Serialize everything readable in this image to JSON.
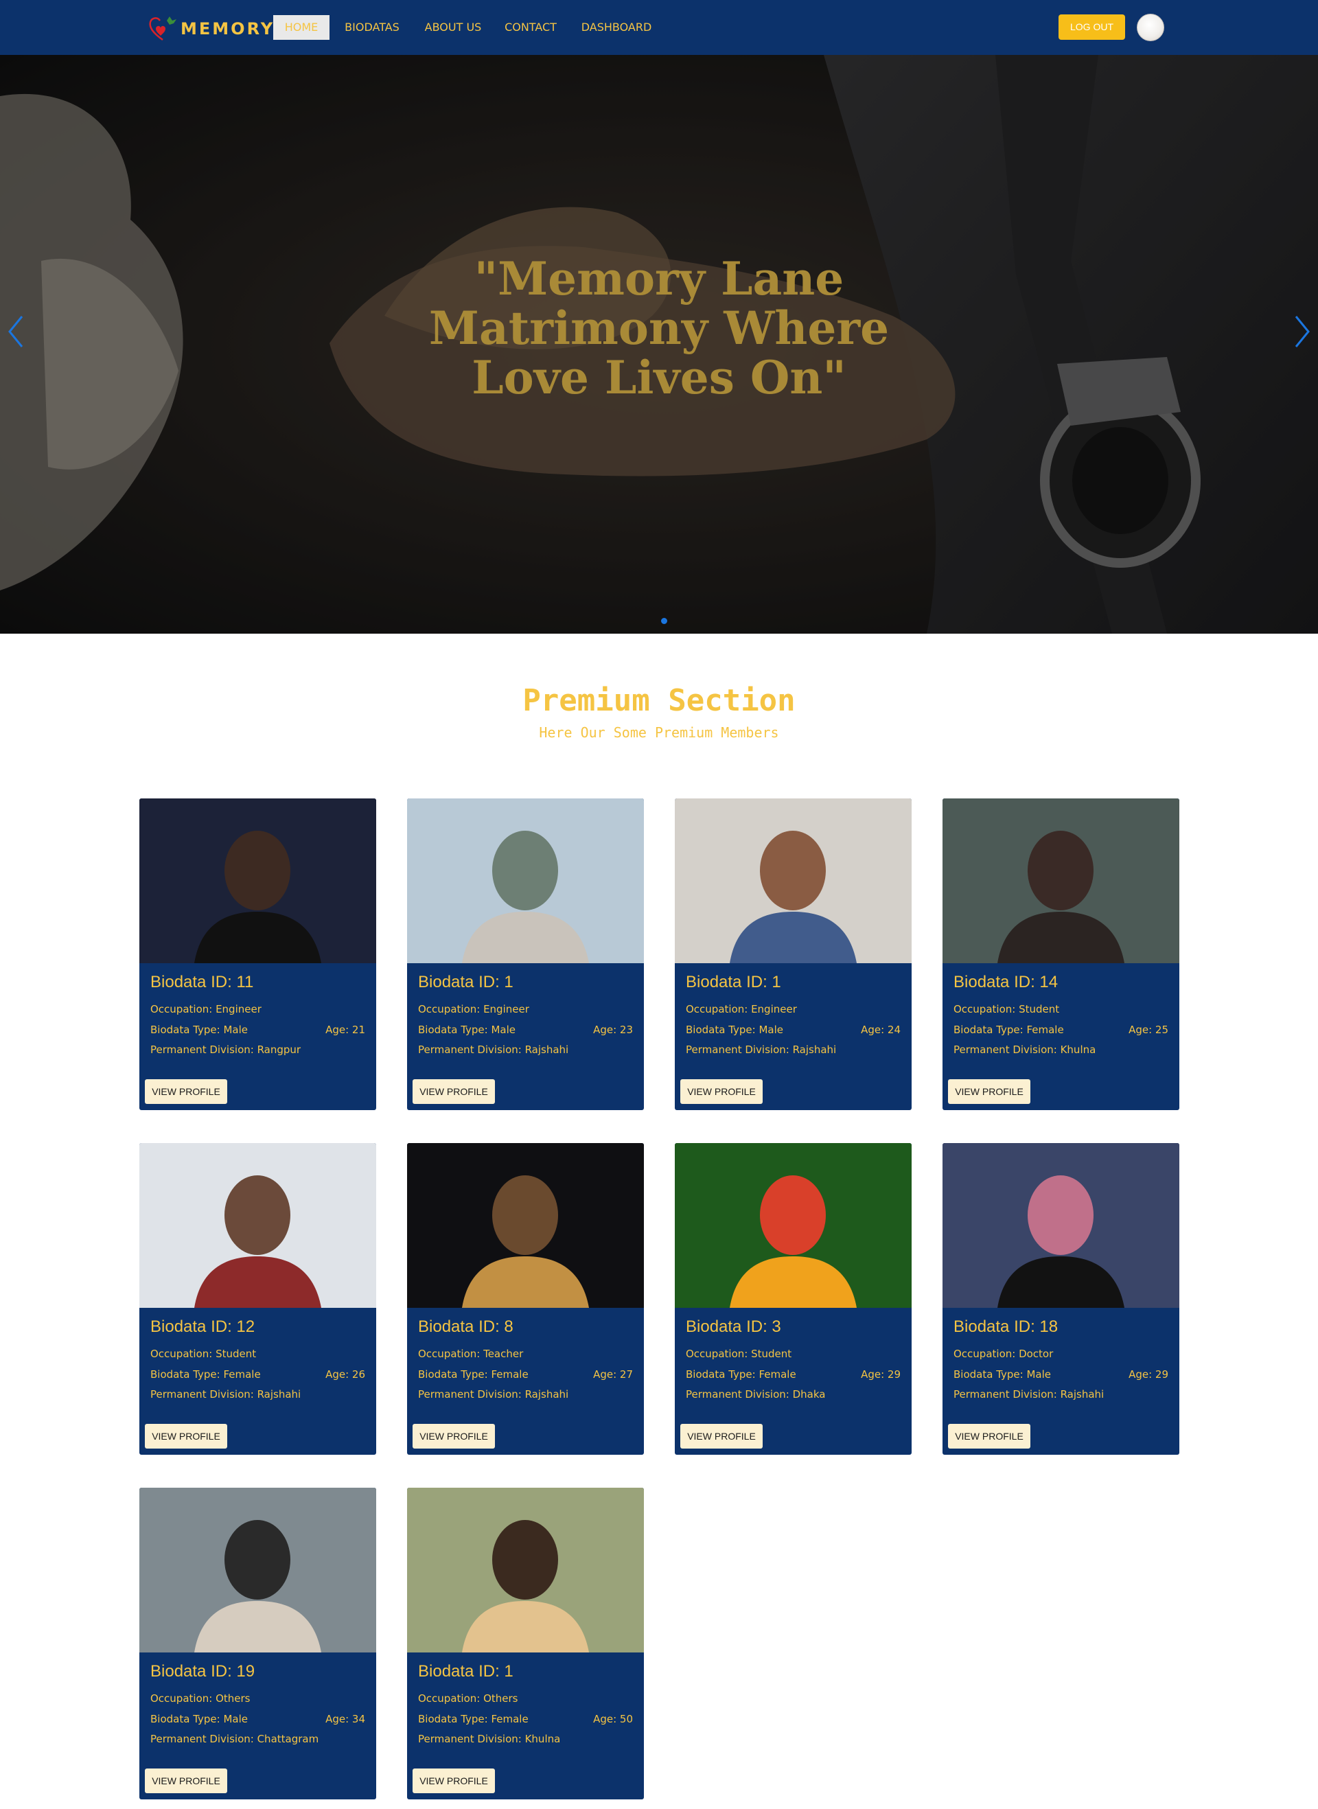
{
  "brand": {
    "name": "MEMORY",
    "colors": {
      "navy": "#0c326b",
      "gold": "#f5c443",
      "button": "#f7be19"
    }
  },
  "nav": {
    "links": [
      {
        "label": "HOME",
        "active": true
      },
      {
        "label": "BIODATAS",
        "active": false
      },
      {
        "label": "ABOUT US",
        "active": false
      },
      {
        "label": "CONTACT",
        "active": false
      },
      {
        "label": "DASHBOARD",
        "active": false
      }
    ],
    "logout_label": "LOG OUT",
    "avatar_icon": "user-avatar"
  },
  "hero": {
    "title": "\"Memory Lane Matrimony Where Love Lives On\"",
    "prev_icon": "chevron-left-icon",
    "next_icon": "chevron-right-icon",
    "active_slide": 1,
    "slide_count": 1
  },
  "premium": {
    "title": "Premium Section",
    "subtitle": "Here Our Some Premium Members",
    "view_label": "VIEW PROFILE",
    "members": [
      {
        "title": "Biodata ID: 11",
        "occupation": "Occupation: Engineer",
        "type": "Biodata Type: Male",
        "age": "Age: 21",
        "division": "Permanent Division: Rangpur"
      },
      {
        "title": "Biodata ID: 1",
        "occupation": "Occupation: Engineer",
        "type": "Biodata Type: Male",
        "age": "Age: 23",
        "division": "Permanent Division: Rajshahi"
      },
      {
        "title": "Biodata ID: 1",
        "occupation": "Occupation: Engineer",
        "type": "Biodata Type: Male",
        "age": "Age: 24",
        "division": "Permanent Division: Rajshahi"
      },
      {
        "title": "Biodata ID: 14",
        "occupation": "Occupation: Student",
        "type": "Biodata Type: Female",
        "age": "Age: 25",
        "division": "Permanent Division: Khulna"
      },
      {
        "title": "Biodata ID: 12",
        "occupation": "Occupation: Student",
        "type": "Biodata Type: Female",
        "age": "Age: 26",
        "division": "Permanent Division: Rajshahi"
      },
      {
        "title": "Biodata ID: 8",
        "occupation": "Occupation: Teacher",
        "type": "Biodata Type: Female",
        "age": "Age: 27",
        "division": "Permanent Division: Rajshahi"
      },
      {
        "title": "Biodata ID: 3",
        "occupation": "Occupation: Student",
        "type": "Biodata Type: Female",
        "age": "Age: 29",
        "division": "Permanent Division: Dhaka"
      },
      {
        "title": "Biodata ID: 18",
        "occupation": "Occupation: Doctor",
        "type": "Biodata Type: Male",
        "age": "Age: 29",
        "division": "Permanent Division: Rajshahi"
      },
      {
        "title": "Biodata ID: 19",
        "occupation": "Occupation: Others",
        "type": "Biodata Type: Male",
        "age": "Age: 34",
        "division": "Permanent Division: Chattagram"
      },
      {
        "title": "Biodata ID: 1",
        "occupation": "Occupation: Others",
        "type": "Biodata Type: Female",
        "age": "Age: 50",
        "division": "Permanent Division: Khulna"
      }
    ]
  }
}
